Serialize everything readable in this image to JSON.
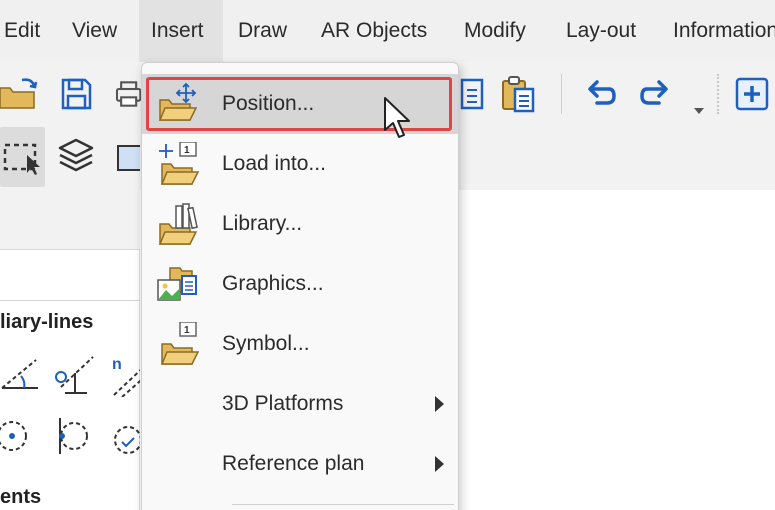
{
  "menubar": {
    "items": [
      {
        "label": "Edit"
      },
      {
        "label": "View"
      },
      {
        "label": "Insert"
      },
      {
        "label": "Draw"
      },
      {
        "label": "AR Objects"
      },
      {
        "label": "Modify"
      },
      {
        "label": "Lay-out"
      },
      {
        "label": "Information"
      }
    ],
    "active_label": "Insert"
  },
  "insert_menu": {
    "items": [
      {
        "label": "Position...",
        "icon": "folder-move-icon",
        "highlighted": true
      },
      {
        "label": "Load into...",
        "icon": "folder-load-icon"
      },
      {
        "label": "Library...",
        "icon": "folder-library-icon"
      },
      {
        "label": "Graphics...",
        "icon": "graphics-icon"
      },
      {
        "label": "Symbol...",
        "icon": "folder-symbol-icon"
      },
      {
        "label": "3D Platforms",
        "submenu": true
      },
      {
        "label": "Reference plan",
        "submenu": true
      }
    ]
  },
  "left_panel": {
    "section1_title": "liary-lines",
    "section2_title": "ents"
  },
  "colors": {
    "accent_blue": "#1f5fbf",
    "folder": "#e3b85a",
    "highlight_border": "#e04444"
  }
}
